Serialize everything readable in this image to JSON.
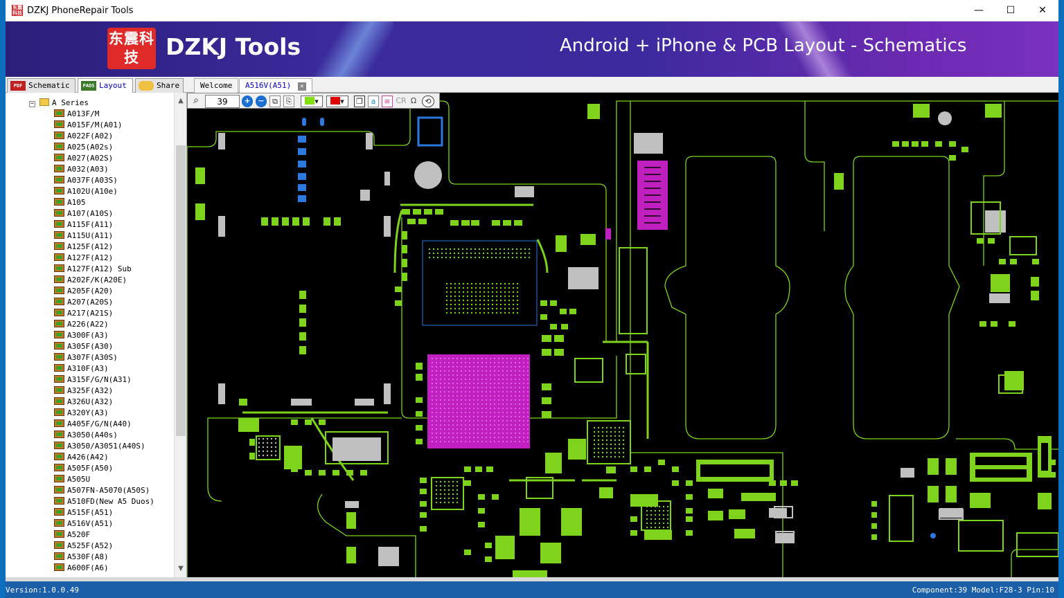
{
  "window": {
    "title": "DZKJ PhoneRepair Tools",
    "minimize": "—",
    "maximize": "☐",
    "close": "✕"
  },
  "banner": {
    "logo_text": "东震科技",
    "brand": "DZKJ Tools",
    "tagline": "Android + iPhone & PCB Layout - Schematics"
  },
  "mode_tabs": [
    {
      "label": "Schematic",
      "icon": "PDF",
      "color": "#c02020"
    },
    {
      "label": "Layout",
      "icon": "PADS",
      "color": "#3a7a2a"
    },
    {
      "label": "Share",
      "icon": "share-icon",
      "color": "#3a8ad0"
    }
  ],
  "doc_tabs": [
    {
      "label": "Welcome"
    },
    {
      "label": "A516V(A51)",
      "close": "✕"
    }
  ],
  "tree": {
    "root": "A Series",
    "items": [
      "A013F/M",
      "A015F/M(A01)",
      "A022F(A02)",
      "A025(A02s)",
      "A027(A02S)",
      "A032(A03)",
      "A037F(A03S)",
      "A102U(A10e)",
      "A105",
      "A107(A10S)",
      "A115F(A11)",
      "A115U(A11)",
      "A125F(A12)",
      "A127F(A12)",
      "A127F(A12) Sub",
      "A202F/K(A20E)",
      "A205F(A20)",
      "A207(A20S)",
      "A217(A21S)",
      "A226(A22)",
      "A300F(A3)",
      "A305F(A30)",
      "A307F(A30S)",
      "A310F(A3)",
      "A315F/G/N(A31)",
      "A325F(A32)",
      "A326U(A32)",
      "A320Y(A3)",
      "A405F/G/N(A40)",
      "A3050(A40s)",
      "A3050/A3051(A40S)",
      "A426(A42)",
      "A505F(A50)",
      "A505U",
      "A507FN-A5070(A50S)",
      "A510FD(New A5 Duos)",
      "A515F(A51)",
      "A516V(A51)",
      "A520F",
      "A525F(A52)",
      "A530F(A8)",
      "A600F(A6)"
    ]
  },
  "toolbar": {
    "zoom_value": "39",
    "icons": [
      "search-icon",
      "zoom-in-icon",
      "zoom-out-icon",
      "fit-icon",
      "copy-icon",
      "top-layer-color",
      "bottom-layer-color",
      "layers-icon",
      "text-icon",
      "pin-icon",
      "cr-label",
      "ohm-icon",
      "reset-icon"
    ],
    "top_color": "#80e010",
    "bottom_color": "#e00000",
    "cr_label": "CR",
    "ohm_label": "Ω"
  },
  "board": {
    "outline_color": "#7ed31c",
    "highlight_color": "#c020c0"
  },
  "status": {
    "version": "Version:1.0.0.49",
    "info": "Component:39 Model:F28-3 Pin:10"
  }
}
